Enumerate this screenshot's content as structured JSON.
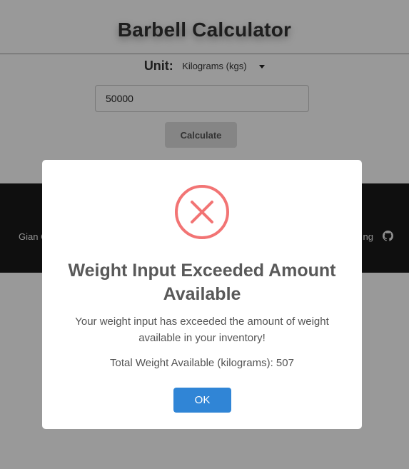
{
  "header": {
    "title": "Barbell Calculator"
  },
  "form": {
    "unit_label": "Unit:",
    "unit_selected": "Kilograms (kgs)",
    "weight_value": "50000",
    "calculate_label": "Calculate"
  },
  "footer": {
    "left_text": "Gian C",
    "right_text": "ng",
    "icon": "github-icon"
  },
  "modal": {
    "icon": "error-x-icon",
    "title": "Weight Input Exceeded Amount Available",
    "message": "Your weight input has exceeded the amount of weight available in your inventory!",
    "total": "Total Weight Available (kilograms): 507",
    "ok_label": "OK"
  },
  "colors": {
    "overlay": "#000000",
    "error": "#f27474",
    "primary_button": "#3085d6",
    "footer_bg": "#1a1a1a"
  }
}
